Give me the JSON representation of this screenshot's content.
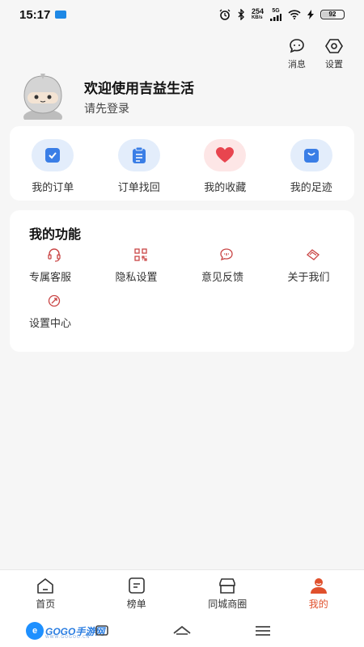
{
  "status_bar": {
    "time": "15:17",
    "net_speed_top": "254",
    "net_speed_bottom": "KB/s",
    "network_type": "5G",
    "battery": "92"
  },
  "top_actions": {
    "messages_label": "消息",
    "settings_label": "设置"
  },
  "profile": {
    "title": "欢迎使用吉益生活",
    "subtitle": "请先登录"
  },
  "orders": [
    {
      "label": "我的订单",
      "icon": "check-clipboard-icon",
      "bg": "#e3edfb",
      "color": "#3a7ee6"
    },
    {
      "label": "订单找回",
      "icon": "list-clipboard-icon",
      "bg": "#e3edfb",
      "color": "#3a7ee6"
    },
    {
      "label": "我的收藏",
      "icon": "heart-icon",
      "bg": "#fde6e6",
      "color": "#e8454f"
    },
    {
      "label": "我的足迹",
      "icon": "shopping-bag-icon",
      "bg": "#e3edfb",
      "color": "#3a7ee6"
    }
  ],
  "functions": {
    "title": "我的功能",
    "items": [
      {
        "label": "专属客服",
        "icon": "headset-icon"
      },
      {
        "label": "隐私设置",
        "icon": "qr-code-icon"
      },
      {
        "label": "意见反馈",
        "icon": "feedback-icon"
      },
      {
        "label": "关于我们",
        "icon": "info-card-icon"
      },
      {
        "label": "设置中心",
        "icon": "settings-icon"
      }
    ]
  },
  "bottom_nav": {
    "items": [
      {
        "label": "首页",
        "icon": "home-icon"
      },
      {
        "label": "榜单",
        "icon": "list-icon"
      },
      {
        "label": "同城商圈",
        "icon": "store-icon"
      },
      {
        "label": "我的",
        "icon": "user-icon",
        "active": true
      }
    ]
  },
  "watermark": {
    "text": "GOGO手游网",
    "sub": "WWW.GOGOO.CN"
  },
  "colors": {
    "accent": "#e0502c",
    "icon_red": "#c94545",
    "icon_blue": "#3a7ee6"
  }
}
